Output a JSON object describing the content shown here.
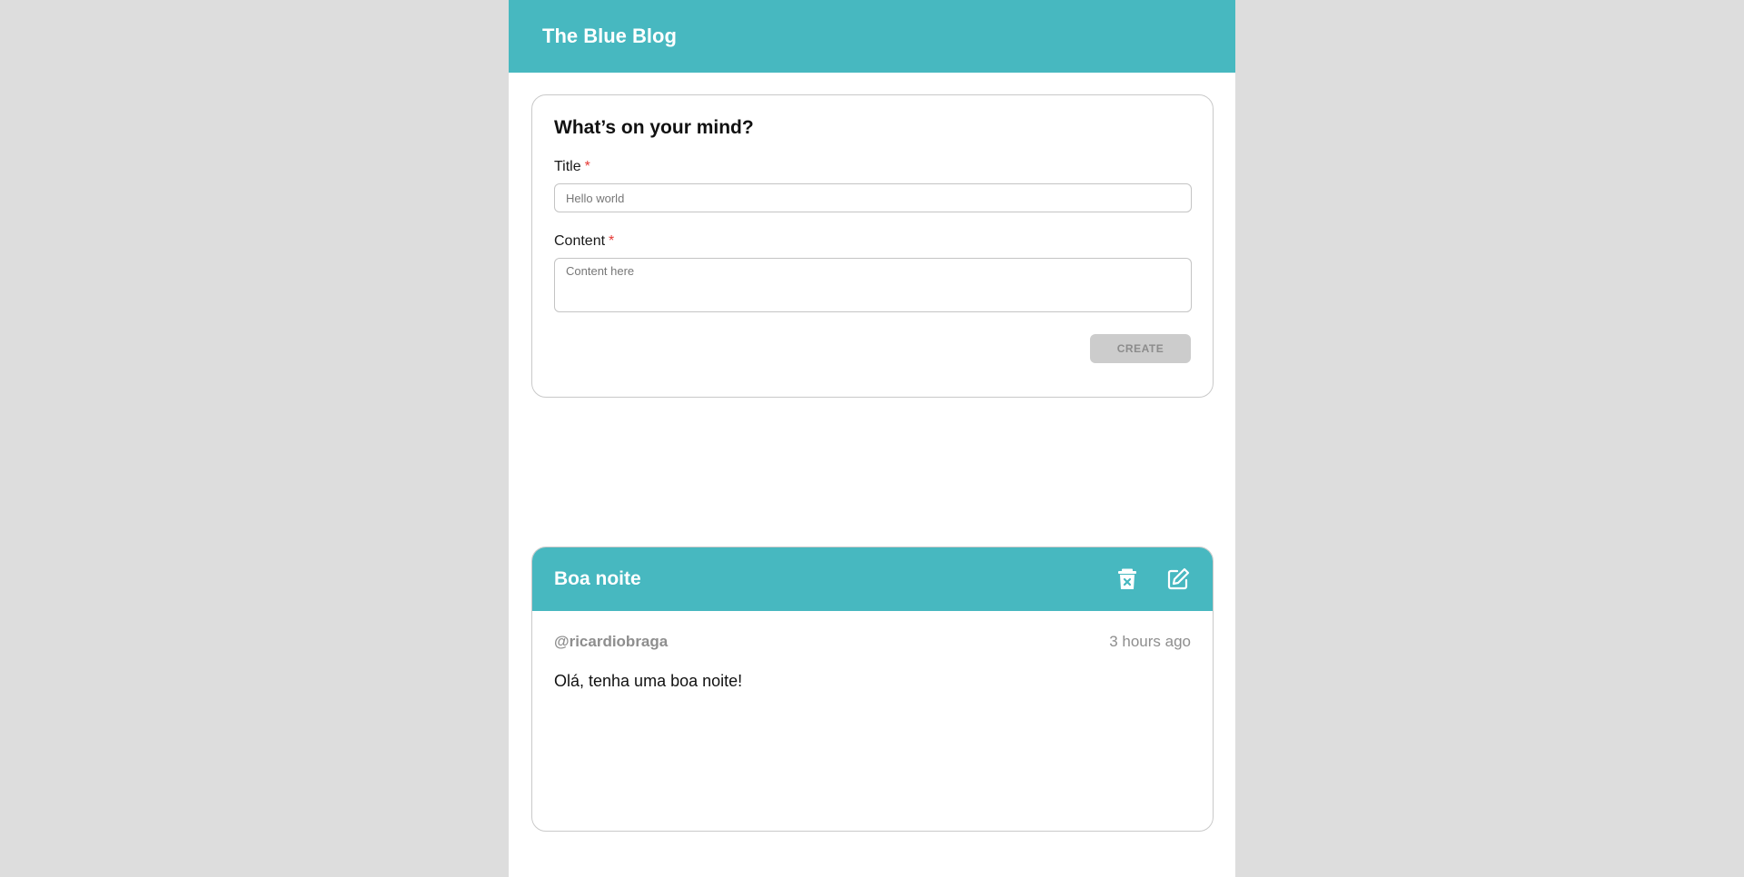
{
  "header": {
    "title": "The Blue Blog"
  },
  "compose": {
    "heading": "What’s on your mind?",
    "title_label": "Title",
    "title_required": "*",
    "title_placeholder": "Hello world",
    "content_label": "Content",
    "content_required": "*",
    "content_placeholder": "Content here",
    "create_label": "CREATE"
  },
  "posts": [
    {
      "title": "Boa noite",
      "author": "@ricardiobraga",
      "time": "3 hours ago",
      "content": "Olá, tenha uma boa noite!",
      "delete_icon": "trash-x-icon",
      "edit_icon": "edit-icon"
    }
  ],
  "colors": {
    "accent": "#47b8c0",
    "page_bg": "#dddddd",
    "required": "#e53935"
  }
}
